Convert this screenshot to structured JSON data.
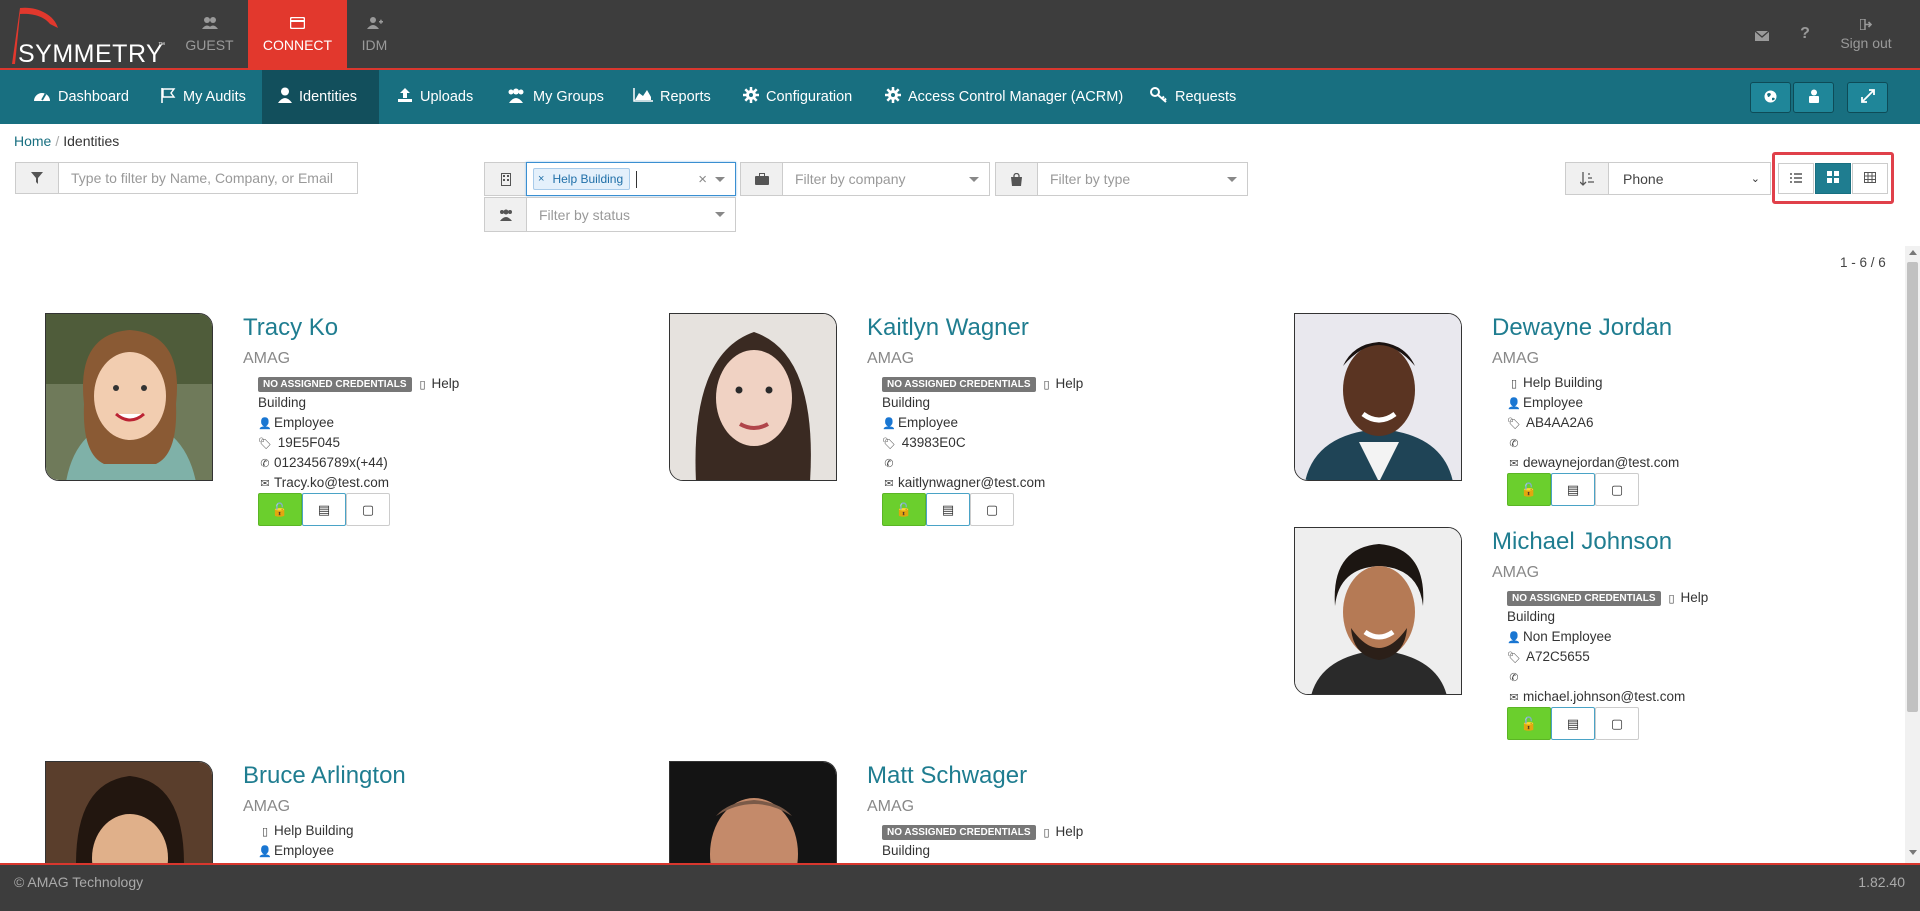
{
  "app": {
    "logo_text": "SYMMETRY",
    "logo_tm": "™",
    "tabs": [
      {
        "label": "GUEST",
        "icon": "users-icon"
      },
      {
        "label": "CONNECT",
        "icon": "card-icon"
      },
      {
        "label": "IDM",
        "icon": "user-plus-icon"
      }
    ],
    "sign_out": "Sign out"
  },
  "nav": {
    "items": [
      {
        "label": "Dashboard",
        "icon": "dashboard-icon"
      },
      {
        "label": "My Audits",
        "icon": "flag-icon"
      },
      {
        "label": "Identities",
        "icon": "user-icon"
      },
      {
        "label": "Uploads",
        "icon": "upload-icon"
      },
      {
        "label": "My Groups",
        "icon": "group-icon"
      },
      {
        "label": "Reports",
        "icon": "area-chart-icon"
      },
      {
        "label": "Configuration",
        "icon": "gear-icon"
      },
      {
        "label": "Access Control Manager (ACRM)",
        "icon": "gear-icon"
      },
      {
        "label": "Requests",
        "icon": "key-icon"
      }
    ]
  },
  "breadcrumb": {
    "home": "Home",
    "current": "Identities"
  },
  "filters": {
    "name_placeholder": "Type to filter by Name, Company, or Email",
    "building_tag": "Help Building",
    "company_placeholder": "Filter by company",
    "type_placeholder": "Filter by type",
    "status_placeholder": "Filter by status"
  },
  "sort": {
    "value": "Phone"
  },
  "count": "1 - 6 / 6",
  "cards": [
    {
      "name": "Tracy Ko",
      "company": "AMAG",
      "badge": "NO ASSIGNED CREDENTIALS",
      "building_a": "Help",
      "building_b": "Building",
      "type": "Employee",
      "tag": "19E5F045",
      "phone": "0123456789x(+44)",
      "email": "Tracy.ko@test.com"
    },
    {
      "name": "Kaitlyn Wagner",
      "company": "AMAG",
      "badge": "NO ASSIGNED CREDENTIALS",
      "building_a": "Help",
      "building_b": "Building",
      "type": "Employee",
      "tag": "43983E0C",
      "phone": "",
      "email": "kaitlynwagner@test.com"
    },
    {
      "name": "Dewayne Jordan",
      "company": "AMAG",
      "building": "Help Building",
      "type": "Employee",
      "tag": "AB4AA2A6",
      "phone": "",
      "email": "dewaynejordan@test.com"
    },
    {
      "name": "Michael Johnson",
      "company": "AMAG",
      "badge": "NO ASSIGNED CREDENTIALS",
      "building_a": "Help",
      "building_b": "Building",
      "type": "Non Employee",
      "tag": "A72C5655",
      "phone": "",
      "email": "michael.johnson@test.com"
    },
    {
      "name": "Bruce Arlington",
      "company": "AMAG",
      "building": "Help Building",
      "type": "Employee"
    },
    {
      "name": "Matt Schwager",
      "company": "AMAG",
      "badge": "NO ASSIGNED CREDENTIALS",
      "building_a": "Help",
      "building_b": "Building"
    }
  ],
  "footer": {
    "copyright": "© AMAG Technology",
    "version": "1.82.40"
  },
  "colors": {
    "brand_red": "#e2382d",
    "nav_teal": "#186f80",
    "green_button": "#6bcf2d"
  }
}
